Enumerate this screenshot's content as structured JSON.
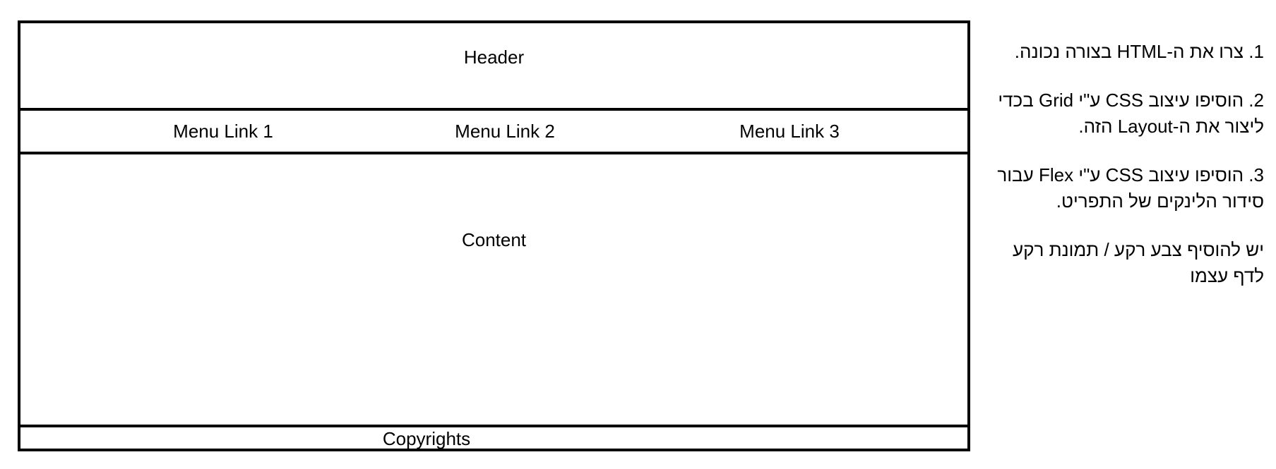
{
  "wireframe": {
    "header": "Header",
    "menu_links": [
      "Menu Link 1",
      "Menu Link 2",
      "Menu Link 3"
    ],
    "content": "Content",
    "footer": "Copyrights"
  },
  "instructions": [
    "1. צרו את ה-HTML בצורה נכונה.",
    "2. הוסיפו עיצוב CSS ע\"י Grid בכדי ליצור את ה-Layout הזה.",
    "3. הוסיפו עיצוב CSS ע\"י Flex עבור סידור הלינקים של התפריט.",
    "יש להוסיף צבע רקע / תמונת רקע לדף עצמו"
  ]
}
